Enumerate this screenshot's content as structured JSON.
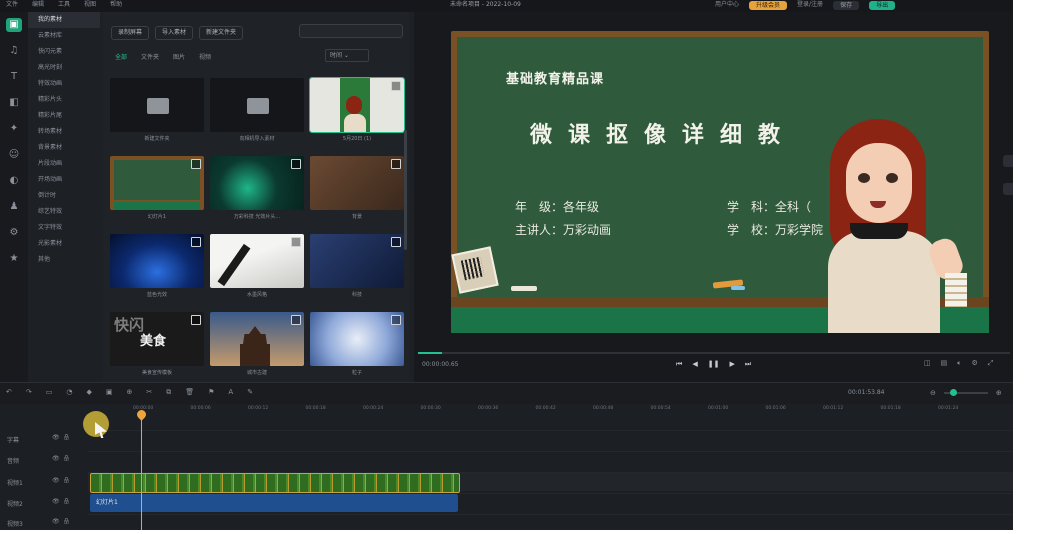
{
  "topbar": {
    "menu": [
      "文件",
      "编辑",
      "工具",
      "视图",
      "帮助"
    ],
    "title": "未命名项目 - 2022-10-09",
    "right_items": [
      "用户中心",
      "升级会员",
      "登录/注册",
      "保存",
      "导出"
    ]
  },
  "sidebar": {
    "icons": [
      "media-icon",
      "music-icon",
      "text-icon",
      "transition-icon",
      "effect-icon",
      "sticker-icon",
      "filter-icon",
      "ai-icon",
      "template-icon",
      "star-icon"
    ]
  },
  "categories": [
    "我的素材",
    "云素材库",
    "快闪元素",
    "高光时刻",
    "特效动画",
    "精彩片头",
    "精彩片尾",
    "转场素材",
    "背景素材",
    "片段动画",
    "开场动画",
    "倒计时",
    "综艺特效",
    "文字特效",
    "光影素材",
    "其他"
  ],
  "media": {
    "buttons": [
      "录制屏幕",
      "导入素材",
      "新建文件夹"
    ],
    "search_placeholder": "",
    "tabs": [
      "全部",
      "文件夹",
      "图片",
      "视频"
    ],
    "sort_label": "时间",
    "tiles": [
      {
        "caption": "新建文件夹",
        "kind": "folder"
      },
      {
        "caption": "向相机导入素材",
        "kind": "folder"
      },
      {
        "caption": "5月20日 (1)",
        "kind": "avatar"
      },
      {
        "caption": "幻灯片1",
        "kind": "board"
      },
      {
        "caption": "万彩科技 光效片头...",
        "kind": "teal"
      },
      {
        "caption": "背景",
        "kind": "brown"
      },
      {
        "caption": "蓝色光效",
        "kind": "blue"
      },
      {
        "caption": "水墨风格",
        "kind": "ink"
      },
      {
        "caption": "科技",
        "kind": "navy"
      },
      {
        "caption": "美食宣传模板",
        "kind": "food"
      },
      {
        "caption": "城市古建",
        "kind": "pagoda"
      },
      {
        "caption": "粒子",
        "kind": "splash"
      }
    ],
    "food_overlay": [
      "快闪",
      "美食"
    ]
  },
  "preview": {
    "board_title": "基础教育精品课",
    "board_subtitle": "微课抠像详细教",
    "info_left": [
      "年　级：各年级",
      "主讲人：万彩动画"
    ],
    "info_right": [
      "学　科：全科（",
      "学　校：万彩学院"
    ],
    "timecode": "00:00:00.65",
    "progress_fraction": 0.04
  },
  "timeline": {
    "total_time": "00:01:53.84",
    "ruler_ticks": [
      "00:00:00",
      "00:00:06",
      "00:00:12",
      "00:00:18",
      "00:00:24",
      "00:00:30",
      "00:00:36",
      "00:00:42",
      "00:00:48",
      "00:00:54",
      "00:01:00",
      "00:01:06",
      "00:01:12",
      "00:01:18",
      "00:01:24"
    ],
    "tracks": [
      "字幕",
      "音频",
      "视频1",
      "视频2",
      "视频3"
    ],
    "blue_clip_label": "幻灯片1"
  }
}
